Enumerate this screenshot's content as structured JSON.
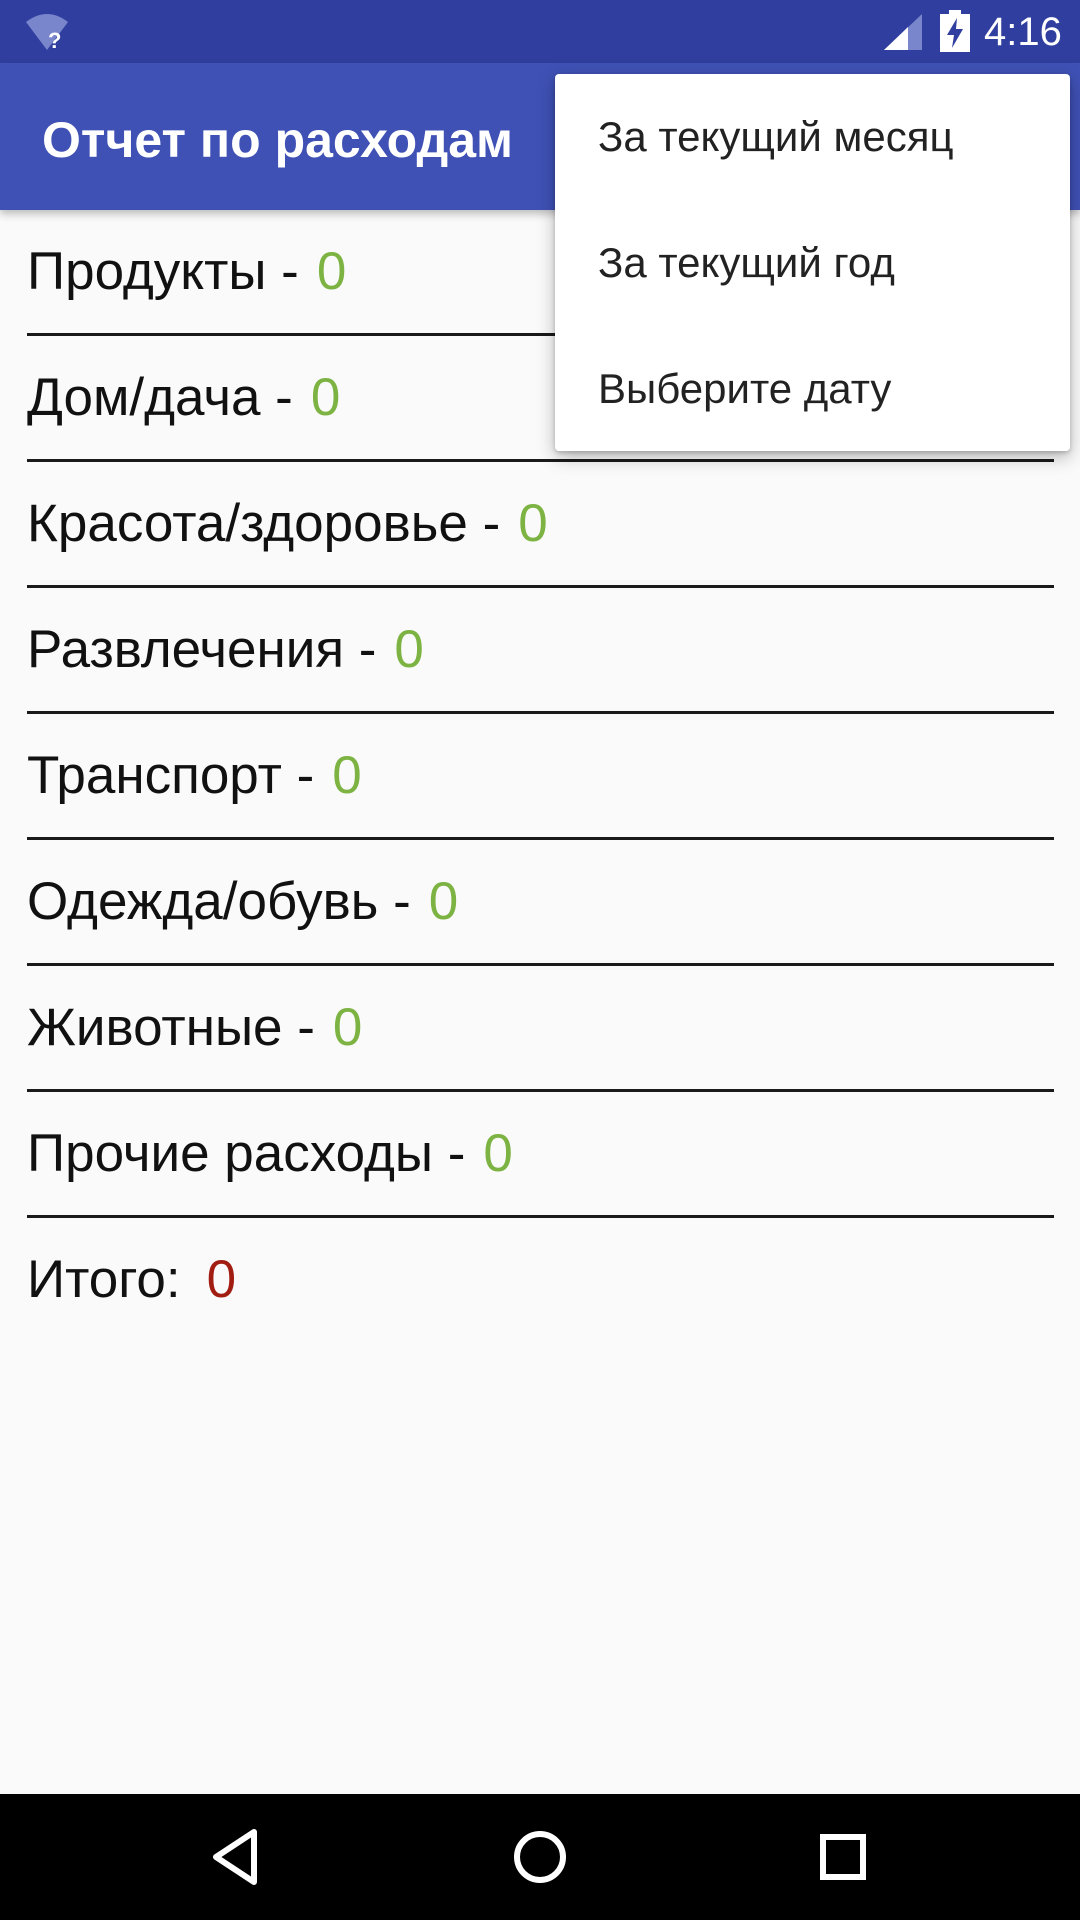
{
  "status_bar": {
    "time": "4:16",
    "icons": [
      "wifi-unknown-icon",
      "cell-signal-icon",
      "battery-charging-icon"
    ],
    "color": "#303f9f"
  },
  "app_bar": {
    "title": "Отчет по расходам",
    "color": "#3f51b5"
  },
  "categories": [
    {
      "label": "Продукты -",
      "value": "0"
    },
    {
      "label": "Дом/дача -",
      "value": "0"
    },
    {
      "label": "Красота/здоровье -",
      "value": "0"
    },
    {
      "label": "Развлечения -",
      "value": "0"
    },
    {
      "label": "Транспорт -",
      "value": "0"
    },
    {
      "label": "Одежда/обувь -",
      "value": "0"
    },
    {
      "label": "Животные -",
      "value": "0"
    },
    {
      "label": "Прочие расходы -",
      "value": "0"
    }
  ],
  "total": {
    "label": "Итого:",
    "value": "0"
  },
  "colors": {
    "value_green": "#7cb342",
    "total_red": "#a11d12"
  },
  "menu": {
    "items": [
      "За текущий месяц",
      "За текущий год",
      "Выберите дату"
    ]
  },
  "nav_bar": {
    "icons": [
      "back-icon",
      "home-icon",
      "recents-icon"
    ]
  }
}
